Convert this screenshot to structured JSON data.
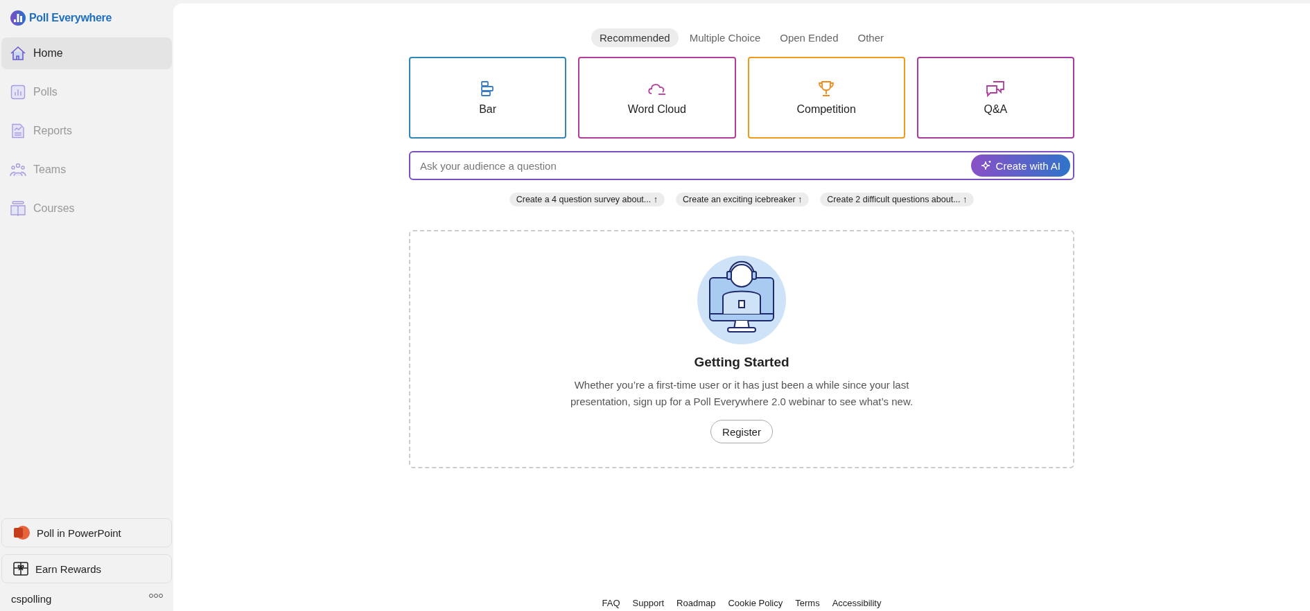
{
  "logo": {
    "text": "Poll Everywhere"
  },
  "sidebar": {
    "items": [
      {
        "label": "Home",
        "selected": true
      },
      {
        "label": "Polls",
        "selected": false
      },
      {
        "label": "Reports",
        "selected": false
      },
      {
        "label": "Teams",
        "selected": false
      },
      {
        "label": "Courses",
        "selected": false
      }
    ],
    "promos": [
      {
        "label": "Poll in PowerPoint"
      },
      {
        "label": "Earn Rewards"
      }
    ],
    "user": {
      "name": "cspolling"
    }
  },
  "tabs": [
    {
      "label": "Recommended",
      "selected": true
    },
    {
      "label": "Multiple Choice",
      "selected": false
    },
    {
      "label": "Open Ended",
      "selected": false
    },
    {
      "label": "Other",
      "selected": false
    }
  ],
  "cards": [
    {
      "label": "Bar",
      "color": "#2f86b8"
    },
    {
      "label": "Word Cloud",
      "color": "#b13c9c"
    },
    {
      "label": "Competition",
      "color": "#f09a1a"
    },
    {
      "label": "Q&A",
      "color": "#a8399f"
    }
  ],
  "prompt": {
    "placeholder": "Ask your audience a question",
    "button": "Create with AI"
  },
  "suggestions": [
    "Create a 4 question survey about... ↑",
    "Create an exciting icebreaker ↑",
    "Create 2 difficult questions about... ↑"
  ],
  "getting_started": {
    "title": "Getting Started",
    "text": "Whether you’re a first-time user or it has just been a while since your last presentation, sign up for a Poll Everywhere 2.0 webinar to see what’s new.",
    "button": "Register"
  },
  "footer": {
    "links": [
      "FAQ",
      "Support",
      "Roadmap",
      "Cookie Policy",
      "Terms",
      "Accessibility"
    ]
  }
}
